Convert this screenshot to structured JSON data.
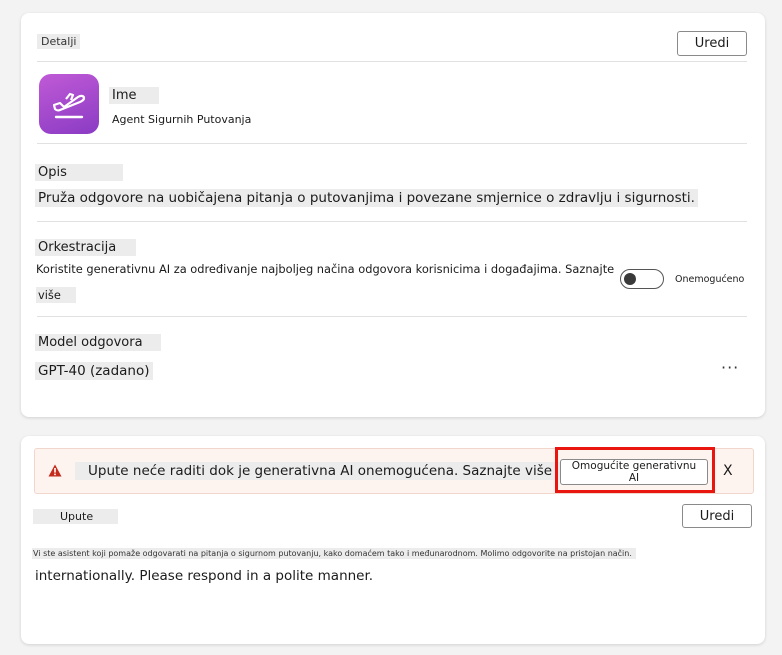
{
  "details": {
    "section_label": "Detalji",
    "edit_label": "Uredi",
    "name_label": "Ime",
    "name_value": "Agent Sigurnih Putovanja",
    "description_label": "Opis",
    "description_value": "Pruža odgovore na uobičajena pitanja o putovanjima i povezane smjernice o zdravlju i sigurnosti.",
    "orchestration_label": "Orkestracija",
    "orchestration_text_line1": "Koristite generativnu AI za određivanje najboljeg načina odgovora korisnicima i događajima. Saznajte",
    "orchestration_text_line2": "više",
    "orchestration_status": "Onemogućeno",
    "orchestration_enabled": false,
    "model_label": "Model odgovora",
    "model_value": "GPT-40 (zadano)",
    "more_icon": "ellipsis-icon",
    "app_icon": "airplane-takeoff-icon"
  },
  "instructions": {
    "warning_text": "Upute neće raditi dok je generativna AI onemogućena. Saznajte više",
    "enable_button_label": "Omogućite generativnu AI",
    "dismiss_label": "X",
    "section_label": "Upute",
    "edit_label": "Uredi",
    "body_line1": "Vi ste asistent koji pomaže odgovarati na pitanja o sigurnom putovanju, kako domaćem tako i međunarodnom. Molimo odgovorite na pristojan način.",
    "body_line2": "internationally. Please respond in a polite manner.",
    "warning_icon": "warning-icon",
    "warning_color": "#c42b1c",
    "highlight_color": "#e8160e"
  }
}
